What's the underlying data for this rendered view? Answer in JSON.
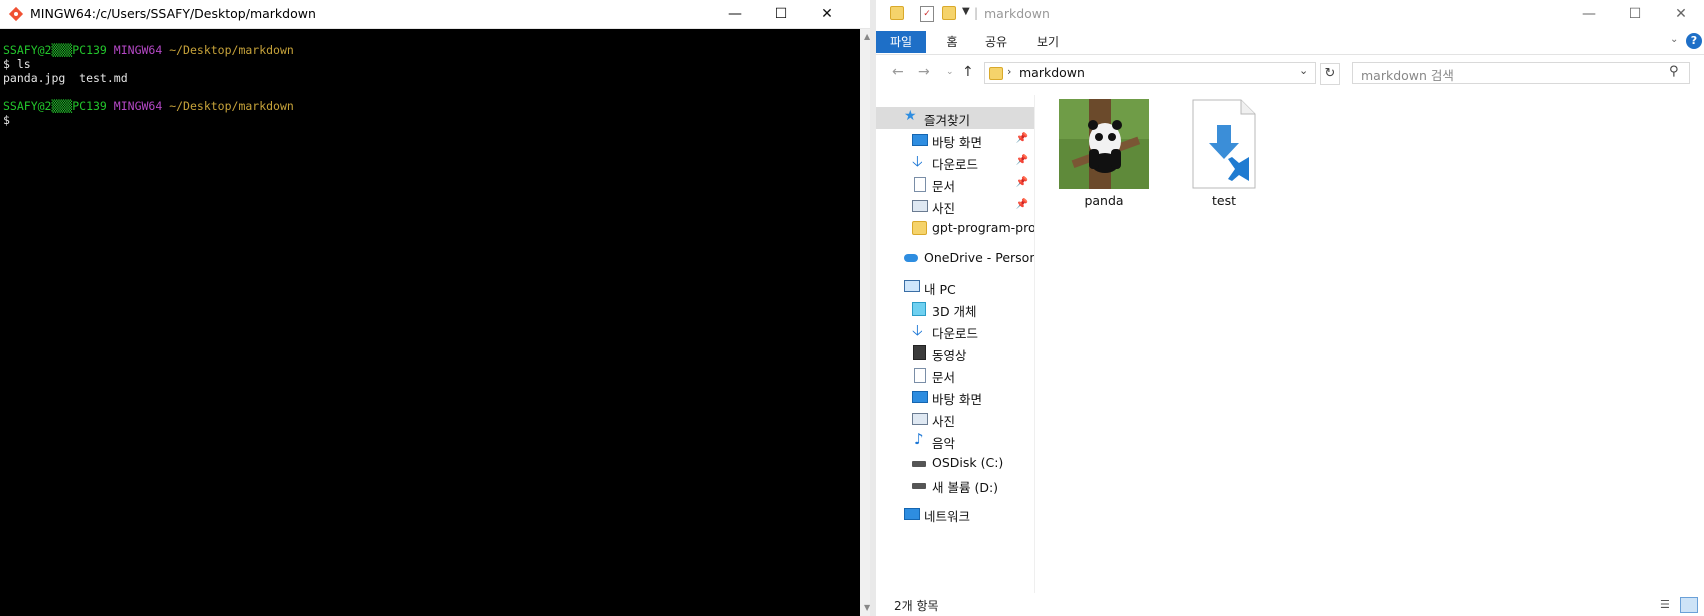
{
  "terminal": {
    "title": "MINGW64:/c/Users/SSAFY/Desktop/markdown",
    "lines": [
      {
        "user": "SSAFY@2▒▒▒PC139",
        "shell": "MINGW64",
        "path": "~/Desktop/markdown"
      },
      {
        "text": "$ ls"
      },
      {
        "text": "panda.jpg  test.md"
      },
      {
        "text": ""
      },
      {
        "user": "SSAFY@2▒▒▒PC139",
        "shell": "MINGW64",
        "path": "~/Desktop/markdown"
      },
      {
        "text": "$"
      }
    ]
  },
  "explorer": {
    "title": "markdown",
    "ribbon_tabs": [
      "파일",
      "홈",
      "공유",
      "보기"
    ],
    "address": "markdown",
    "search_placeholder": "markdown 검색",
    "nav": [
      {
        "label": "즐겨찾기",
        "icon": "star-icon"
      },
      {
        "label": "바탕 화면",
        "icon": "desktop-icon",
        "pinned": true
      },
      {
        "label": "다운로드",
        "icon": "download-icon",
        "pinned": true
      },
      {
        "label": "문서",
        "icon": "document-icon",
        "pinned": true
      },
      {
        "label": "사진",
        "icon": "pictures-icon",
        "pinned": true
      },
      {
        "label": "gpt-program-probl",
        "icon": "folder-icon"
      },
      {
        "label": "OneDrive - Personal",
        "icon": "cloud-icon"
      },
      {
        "label": "내 PC",
        "icon": "pc-icon"
      },
      {
        "label": "3D 개체",
        "icon": "3d-objects-icon"
      },
      {
        "label": "다운로드",
        "icon": "download-icon"
      },
      {
        "label": "동영상",
        "icon": "video-icon"
      },
      {
        "label": "문서",
        "icon": "document-icon"
      },
      {
        "label": "바탕 화면",
        "icon": "desktop-icon"
      },
      {
        "label": "사진",
        "icon": "pictures-icon"
      },
      {
        "label": "음악",
        "icon": "music-icon"
      },
      {
        "label": "OSDisk (C:)",
        "icon": "drive-icon"
      },
      {
        "label": "새 볼륨 (D:)",
        "icon": "drive-icon"
      },
      {
        "label": "네트워크",
        "icon": "network-icon"
      }
    ],
    "files": [
      {
        "name": "panda",
        "icon": "panda-thumbnail-icon"
      },
      {
        "name": "test",
        "icon": "markdown-file-icon"
      }
    ],
    "status": "2개 항목"
  }
}
